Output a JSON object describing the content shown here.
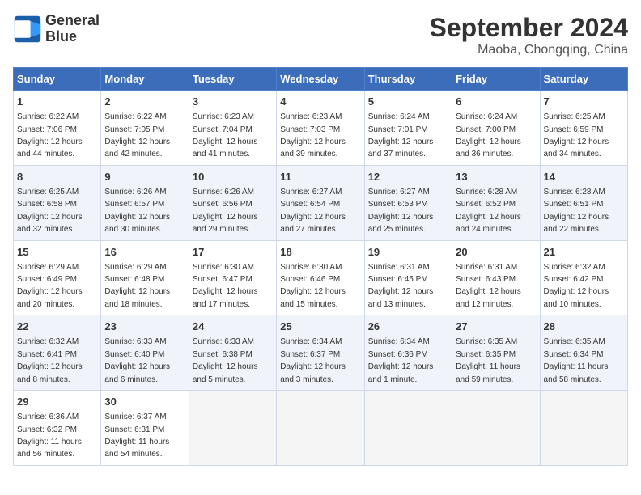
{
  "logo": {
    "line1": "General",
    "line2": "Blue"
  },
  "title": "September 2024",
  "location": "Maoba, Chongqing, China",
  "days_of_week": [
    "Sunday",
    "Monday",
    "Tuesday",
    "Wednesday",
    "Thursday",
    "Friday",
    "Saturday"
  ],
  "weeks": [
    [
      {
        "day": "1",
        "info": "Sunrise: 6:22 AM\nSunset: 7:06 PM\nDaylight: 12 hours\nand 44 minutes."
      },
      {
        "day": "2",
        "info": "Sunrise: 6:22 AM\nSunset: 7:05 PM\nDaylight: 12 hours\nand 42 minutes."
      },
      {
        "day": "3",
        "info": "Sunrise: 6:23 AM\nSunset: 7:04 PM\nDaylight: 12 hours\nand 41 minutes."
      },
      {
        "day": "4",
        "info": "Sunrise: 6:23 AM\nSunset: 7:03 PM\nDaylight: 12 hours\nand 39 minutes."
      },
      {
        "day": "5",
        "info": "Sunrise: 6:24 AM\nSunset: 7:01 PM\nDaylight: 12 hours\nand 37 minutes."
      },
      {
        "day": "6",
        "info": "Sunrise: 6:24 AM\nSunset: 7:00 PM\nDaylight: 12 hours\nand 36 minutes."
      },
      {
        "day": "7",
        "info": "Sunrise: 6:25 AM\nSunset: 6:59 PM\nDaylight: 12 hours\nand 34 minutes."
      }
    ],
    [
      {
        "day": "8",
        "info": "Sunrise: 6:25 AM\nSunset: 6:58 PM\nDaylight: 12 hours\nand 32 minutes."
      },
      {
        "day": "9",
        "info": "Sunrise: 6:26 AM\nSunset: 6:57 PM\nDaylight: 12 hours\nand 30 minutes."
      },
      {
        "day": "10",
        "info": "Sunrise: 6:26 AM\nSunset: 6:56 PM\nDaylight: 12 hours\nand 29 minutes."
      },
      {
        "day": "11",
        "info": "Sunrise: 6:27 AM\nSunset: 6:54 PM\nDaylight: 12 hours\nand 27 minutes."
      },
      {
        "day": "12",
        "info": "Sunrise: 6:27 AM\nSunset: 6:53 PM\nDaylight: 12 hours\nand 25 minutes."
      },
      {
        "day": "13",
        "info": "Sunrise: 6:28 AM\nSunset: 6:52 PM\nDaylight: 12 hours\nand 24 minutes."
      },
      {
        "day": "14",
        "info": "Sunrise: 6:28 AM\nSunset: 6:51 PM\nDaylight: 12 hours\nand 22 minutes."
      }
    ],
    [
      {
        "day": "15",
        "info": "Sunrise: 6:29 AM\nSunset: 6:49 PM\nDaylight: 12 hours\nand 20 minutes."
      },
      {
        "day": "16",
        "info": "Sunrise: 6:29 AM\nSunset: 6:48 PM\nDaylight: 12 hours\nand 18 minutes."
      },
      {
        "day": "17",
        "info": "Sunrise: 6:30 AM\nSunset: 6:47 PM\nDaylight: 12 hours\nand 17 minutes."
      },
      {
        "day": "18",
        "info": "Sunrise: 6:30 AM\nSunset: 6:46 PM\nDaylight: 12 hours\nand 15 minutes."
      },
      {
        "day": "19",
        "info": "Sunrise: 6:31 AM\nSunset: 6:45 PM\nDaylight: 12 hours\nand 13 minutes."
      },
      {
        "day": "20",
        "info": "Sunrise: 6:31 AM\nSunset: 6:43 PM\nDaylight: 12 hours\nand 12 minutes."
      },
      {
        "day": "21",
        "info": "Sunrise: 6:32 AM\nSunset: 6:42 PM\nDaylight: 12 hours\nand 10 minutes."
      }
    ],
    [
      {
        "day": "22",
        "info": "Sunrise: 6:32 AM\nSunset: 6:41 PM\nDaylight: 12 hours\nand 8 minutes."
      },
      {
        "day": "23",
        "info": "Sunrise: 6:33 AM\nSunset: 6:40 PM\nDaylight: 12 hours\nand 6 minutes."
      },
      {
        "day": "24",
        "info": "Sunrise: 6:33 AM\nSunset: 6:38 PM\nDaylight: 12 hours\nand 5 minutes."
      },
      {
        "day": "25",
        "info": "Sunrise: 6:34 AM\nSunset: 6:37 PM\nDaylight: 12 hours\nand 3 minutes."
      },
      {
        "day": "26",
        "info": "Sunrise: 6:34 AM\nSunset: 6:36 PM\nDaylight: 12 hours\nand 1 minute."
      },
      {
        "day": "27",
        "info": "Sunrise: 6:35 AM\nSunset: 6:35 PM\nDaylight: 11 hours\nand 59 minutes."
      },
      {
        "day": "28",
        "info": "Sunrise: 6:35 AM\nSunset: 6:34 PM\nDaylight: 11 hours\nand 58 minutes."
      }
    ],
    [
      {
        "day": "29",
        "info": "Sunrise: 6:36 AM\nSunset: 6:32 PM\nDaylight: 11 hours\nand 56 minutes."
      },
      {
        "day": "30",
        "info": "Sunrise: 6:37 AM\nSunset: 6:31 PM\nDaylight: 11 hours\nand 54 minutes."
      },
      {
        "day": "",
        "info": ""
      },
      {
        "day": "",
        "info": ""
      },
      {
        "day": "",
        "info": ""
      },
      {
        "day": "",
        "info": ""
      },
      {
        "day": "",
        "info": ""
      }
    ]
  ]
}
